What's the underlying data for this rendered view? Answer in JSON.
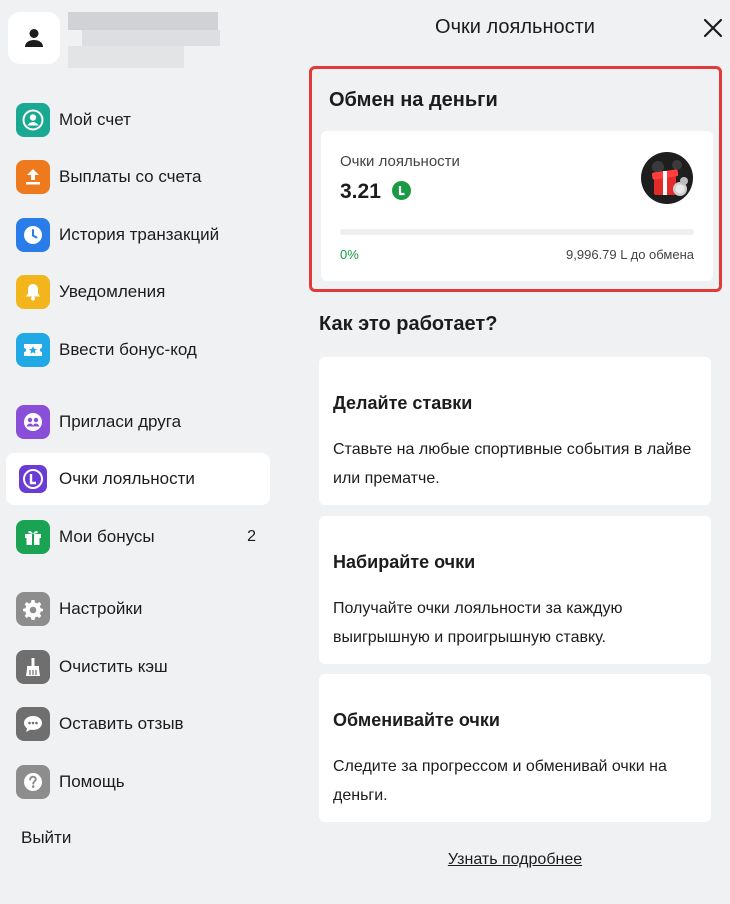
{
  "page": {
    "title": "Очки лояльности"
  },
  "sidebar": {
    "items": [
      {
        "label": "Мой счет",
        "icon": "user-circle-icon",
        "color": "#19a891"
      },
      {
        "label": "Выплаты со счета",
        "icon": "upload-icon",
        "color": "#ef7a1e"
      },
      {
        "label": "История транзакций",
        "icon": "clock-icon",
        "color": "#2a7de8"
      },
      {
        "label": "Уведомления",
        "icon": "bell-icon",
        "color": "#f2b51c"
      },
      {
        "label": "Ввести бонус-код",
        "icon": "ticket-star-icon",
        "color": "#21a9e6"
      },
      {
        "label": "Пригласи друга",
        "icon": "friends-icon",
        "color": "#8a4fd8"
      },
      {
        "label": "Очки лояльности",
        "icon": "loyalty-l-icon",
        "color": "#ffffff",
        "active": true
      },
      {
        "label": "Мои бонусы",
        "icon": "gift-icon",
        "color": "#1aa352",
        "badge": "2"
      },
      {
        "label": "Настройки",
        "icon": "gear-icon",
        "color": "#8d8d8d"
      },
      {
        "label": "Очистить кэш",
        "icon": "broom-icon",
        "color": "#6f6f6f"
      },
      {
        "label": "Оставить отзыв",
        "icon": "chat-bubble-icon",
        "color": "#6f6f6f"
      },
      {
        "label": "Помощь",
        "icon": "question-icon",
        "color": "#8d8d8d"
      }
    ],
    "logout_label": "Выйти"
  },
  "exchange": {
    "title": "Обмен на деньги",
    "points_label": "Очки лояльности",
    "points_value": "3.21",
    "currency_symbol": "L",
    "progress_percent_label": "0%",
    "progress_fraction": 0,
    "remaining_label": "9,996.79 L до обмена",
    "accent_color": "#1a9a45",
    "highlight_color": "#e03a3a"
  },
  "how_it_works": {
    "title": "Как это работает?",
    "steps": [
      {
        "title": "Делайте ставки",
        "description": "Ставьте на любые спортивные события в лайве или прематче."
      },
      {
        "title": "Набирайте очки",
        "description": "Получайте очки лояльности за каждую выигрышную и проигрышную ставку."
      },
      {
        "title": "Обменивайте очки",
        "description": "Следите за прогрессом и обменивай очки на деньги."
      }
    ]
  },
  "learn_more_label": "Узнать подробнее"
}
